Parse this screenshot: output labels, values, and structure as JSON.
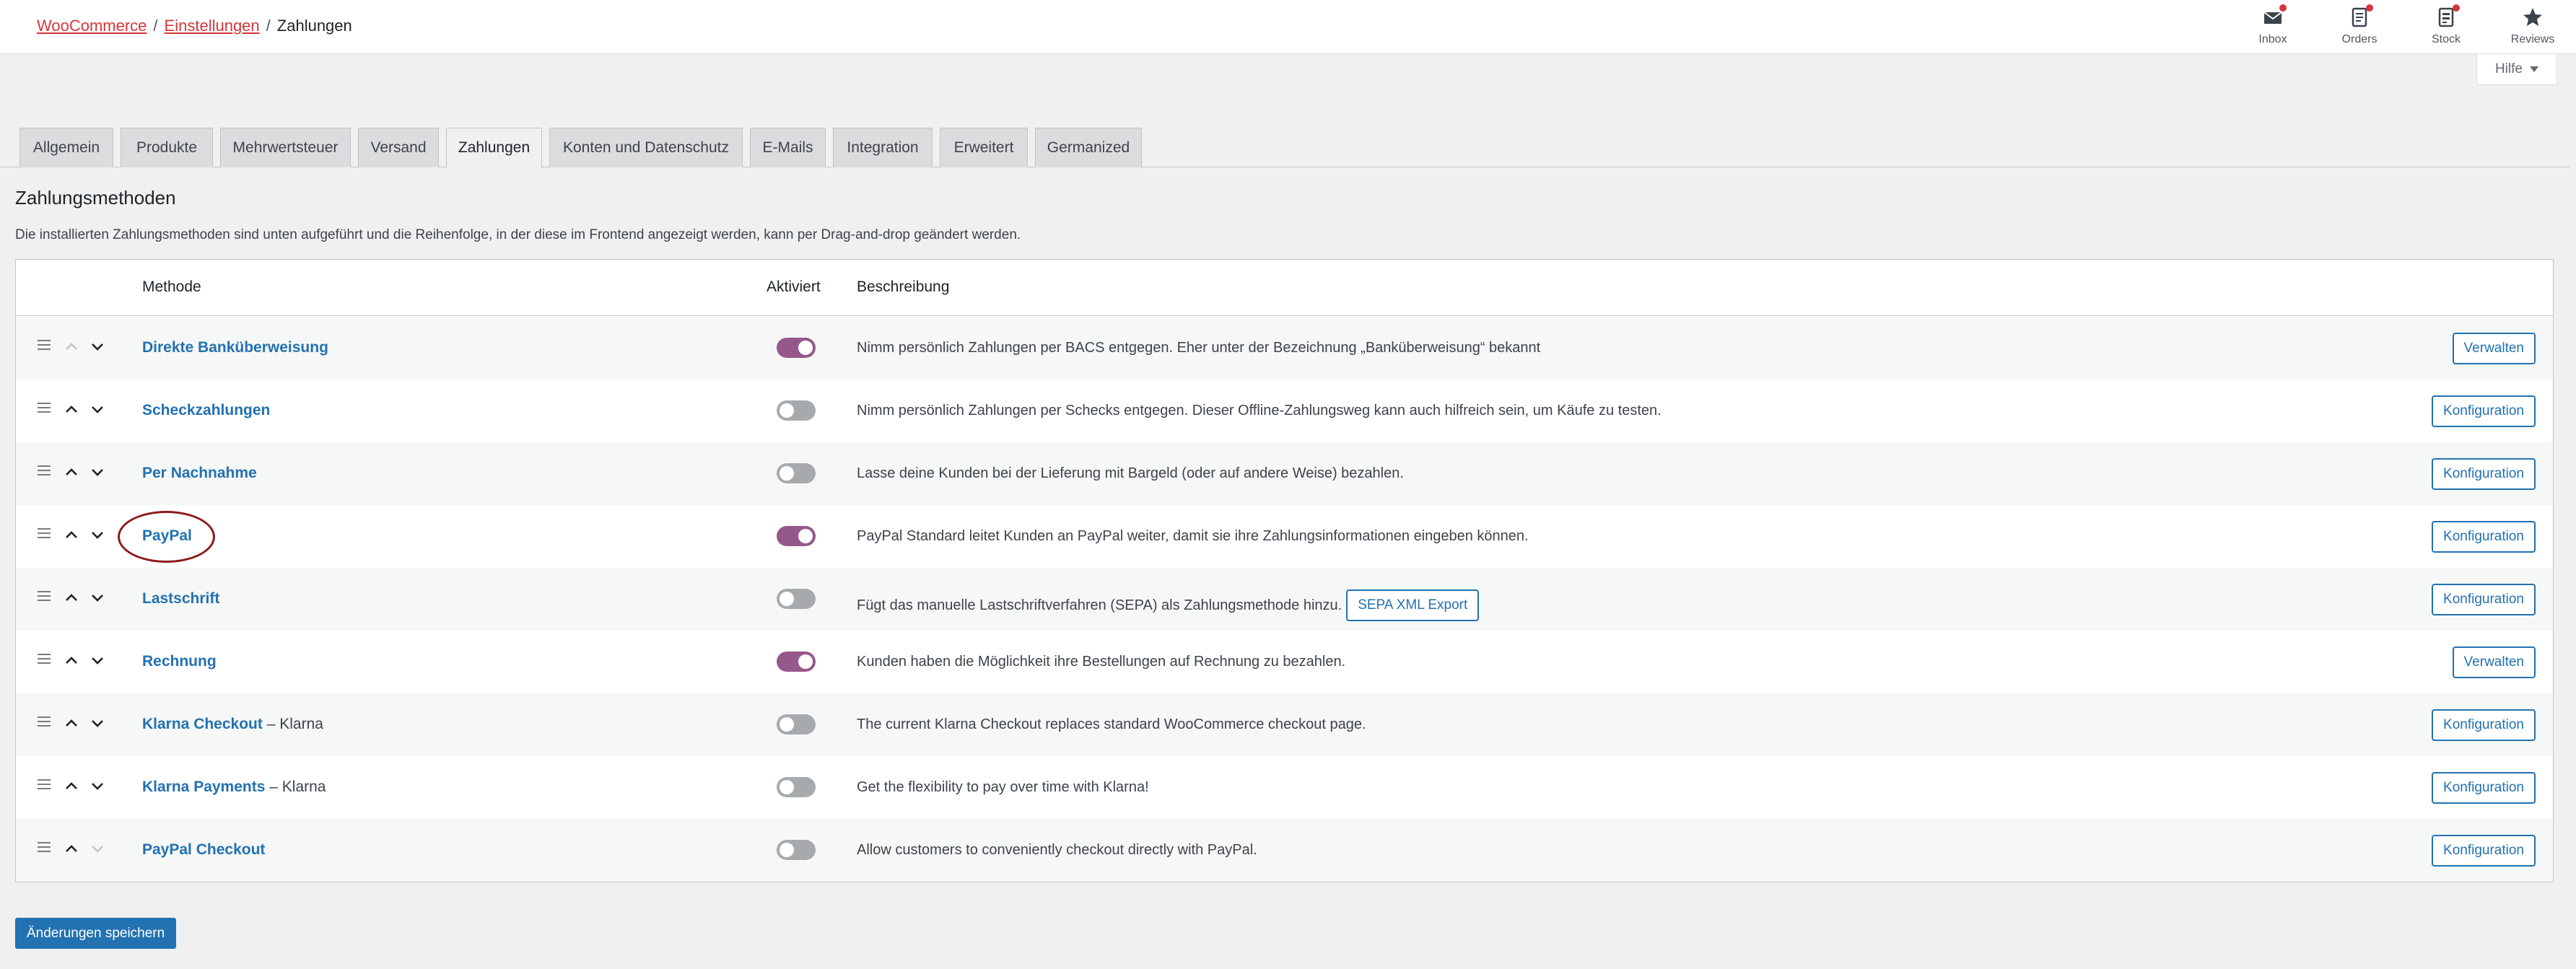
{
  "breadcrumb": {
    "items": [
      "WooCommerce",
      "Einstellungen"
    ],
    "current": "Zahlungen",
    "separator": "/"
  },
  "top_icons": [
    {
      "label": "Inbox",
      "icon": "inbox-icon",
      "badge": true
    },
    {
      "label": "Orders",
      "icon": "orders-icon",
      "badge": true
    },
    {
      "label": "Stock",
      "icon": "stock-icon",
      "badge": true
    },
    {
      "label": "Reviews",
      "icon": "star-icon",
      "badge": false
    }
  ],
  "help": {
    "label": "Hilfe"
  },
  "tabs": [
    {
      "label": "Allgemein",
      "active": false
    },
    {
      "label": "Produkte",
      "active": false
    },
    {
      "label": "Mehrwertsteuer",
      "active": false
    },
    {
      "label": "Versand",
      "active": false
    },
    {
      "label": "Zahlungen",
      "active": true
    },
    {
      "label": "Konten und Datenschutz",
      "active": false
    },
    {
      "label": "E-Mails",
      "active": false
    },
    {
      "label": "Integration",
      "active": false
    },
    {
      "label": "Erweitert",
      "active": false
    },
    {
      "label": "Germanized",
      "active": false
    }
  ],
  "page": {
    "heading": "Zahlungsmethoden",
    "description": "Die installierten Zahlungsmethoden sind unten aufgeführt und die Reihenfolge, in der diese im Frontend angezeigt werden, kann per Drag-and-drop geändert werden."
  },
  "table": {
    "headers": {
      "method": "Methode",
      "enabled": "Aktiviert",
      "description": "Beschreibung"
    },
    "rows": [
      {
        "name": "Direkte Banküberweisung",
        "suffix": "",
        "enabled": true,
        "description": "Nimm persönlich Zahlungen per BACS entgegen. Eher unter der Bezeichnung „Banküberweisung“ bekannt",
        "button": "Verwalten",
        "up_disabled": true,
        "down_disabled": false,
        "extra_button": ""
      },
      {
        "name": "Scheckzahlungen",
        "suffix": "",
        "enabled": false,
        "description": "Nimm persönlich Zahlungen per Schecks entgegen. Dieser Offline-Zahlungsweg kann auch hilfreich sein, um Käufe zu testen.",
        "button": "Konfiguration",
        "up_disabled": false,
        "down_disabled": false,
        "extra_button": ""
      },
      {
        "name": "Per Nachnahme",
        "suffix": "",
        "enabled": false,
        "description": "Lasse deine Kunden bei der Lieferung mit Bargeld (oder auf andere Weise) bezahlen.",
        "button": "Konfiguration",
        "up_disabled": false,
        "down_disabled": false,
        "extra_button": ""
      },
      {
        "name": "PayPal",
        "suffix": "",
        "enabled": true,
        "description": "PayPal Standard leitet Kunden an PayPal weiter, damit sie ihre Zahlungsinformationen eingeben können.",
        "button": "Konfiguration",
        "up_disabled": false,
        "down_disabled": false,
        "extra_button": ""
      },
      {
        "name": "Lastschrift",
        "suffix": "",
        "enabled": false,
        "description": "Fügt das manuelle Lastschriftverfahren (SEPA) als Zahlungsmethode hinzu.",
        "button": "Konfiguration",
        "up_disabled": false,
        "down_disabled": false,
        "extra_button": "SEPA XML Export"
      },
      {
        "name": "Rechnung",
        "suffix": "",
        "enabled": true,
        "description": "Kunden haben die Möglichkeit ihre Bestellungen auf Rechnung zu bezahlen.",
        "button": "Verwalten",
        "up_disabled": false,
        "down_disabled": false,
        "extra_button": ""
      },
      {
        "name": "Klarna Checkout",
        "suffix": "– Klarna",
        "enabled": false,
        "description": "The current Klarna Checkout replaces standard WooCommerce checkout page.",
        "button": "Konfiguration",
        "up_disabled": false,
        "down_disabled": false,
        "extra_button": ""
      },
      {
        "name": "Klarna Payments",
        "suffix": "– Klarna",
        "enabled": false,
        "description": "Get the flexibility to pay over time with Klarna!",
        "button": "Konfiguration",
        "up_disabled": false,
        "down_disabled": false,
        "extra_button": ""
      },
      {
        "name": "PayPal Checkout",
        "suffix": "",
        "enabled": false,
        "description": "Allow customers to conveniently checkout directly with PayPal.",
        "button": "Konfiguration",
        "up_disabled": false,
        "down_disabled": true,
        "extra_button": ""
      }
    ]
  },
  "save_button": {
    "label": "Änderungen speichern"
  },
  "colors": {
    "accent": "#2271b1",
    "toggle_on": "#96588a",
    "toggle_off": "#a7aaad",
    "link_breadcrumb": "#d63638",
    "highlight_circle": "#8b1a1a"
  }
}
